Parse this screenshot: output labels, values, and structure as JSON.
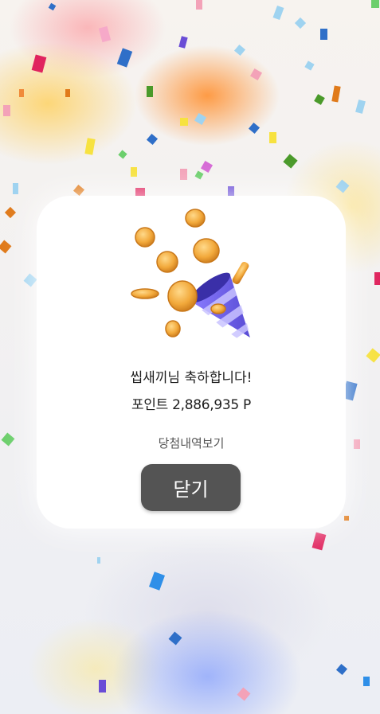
{
  "dialog": {
    "title": "씹새끼님 축하합니다!",
    "points_text": "포인트 2,886,935 P",
    "history_link_label": "당첨내역보기",
    "close_button_label": "닫기"
  },
  "colors": {
    "close_button": "#545454",
    "coin": "#f2a93b",
    "cone": "#6a5ce8"
  },
  "illustration_icon": "coins-party-popper-icon"
}
